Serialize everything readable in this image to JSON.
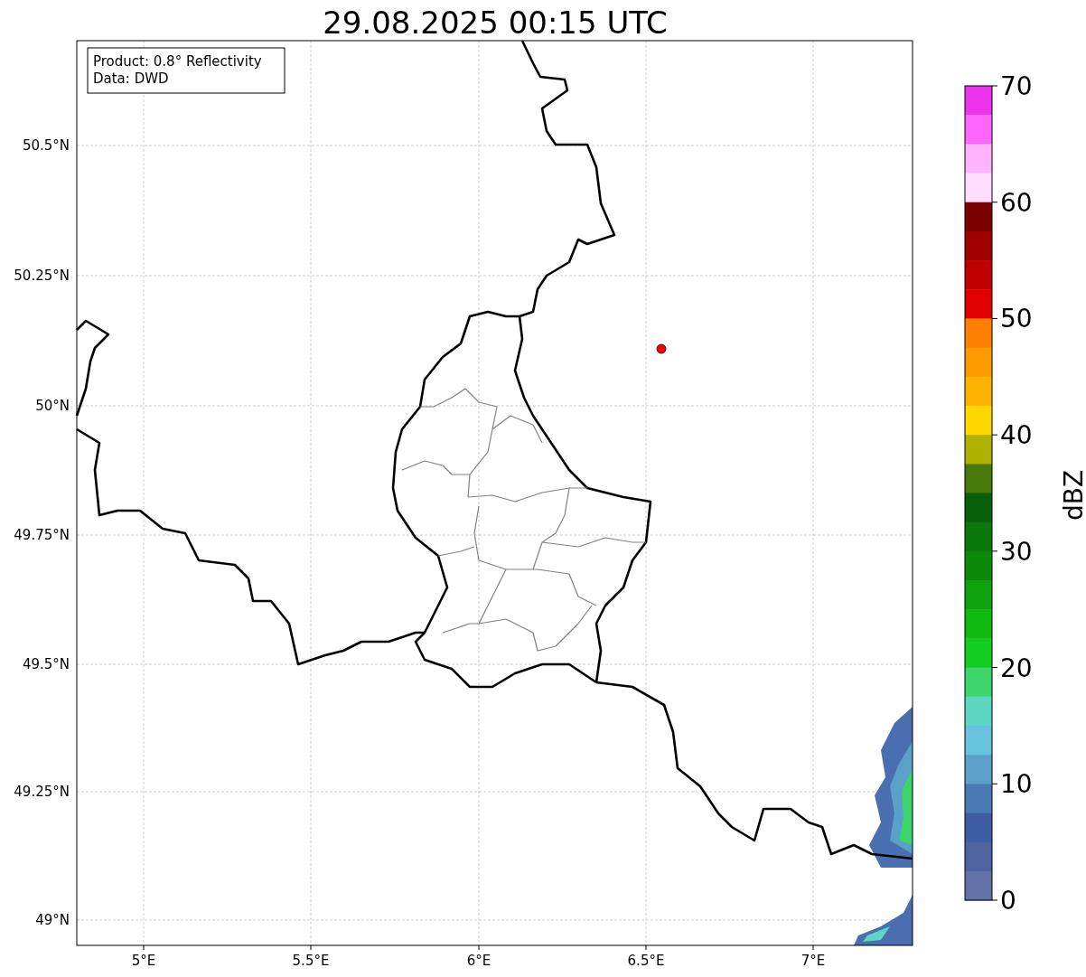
{
  "title": "29.08.2025 00:15 UTC",
  "info_box": [
    "Product: 0.8° Reflectivity",
    "Data: DWD"
  ],
  "x_tick_labels": [
    "5°E",
    "5.5°E",
    "6°E",
    "6.5°E",
    "7°E"
  ],
  "y_tick_labels": [
    "50.5°N",
    "50.25°N",
    "50°N",
    "49.75°N",
    "49.5°N",
    "49.25°N",
    "49°N"
  ],
  "colorbar": {
    "label": "dBZ",
    "tick_labels": [
      "70",
      "60",
      "50",
      "40",
      "30",
      "20",
      "10",
      "0"
    ],
    "bins": [
      {
        "color": "#ee33ee"
      },
      {
        "color": "#ff66ff"
      },
      {
        "color": "#ffb3ff"
      },
      {
        "color": "#ffddff"
      },
      {
        "color": "#7b0000"
      },
      {
        "color": "#a00000"
      },
      {
        "color": "#c00000"
      },
      {
        "color": "#e00000"
      },
      {
        "color": "#ff7f00"
      },
      {
        "color": "#ff9900"
      },
      {
        "color": "#ffb300"
      },
      {
        "color": "#ffd700"
      },
      {
        "color": "#b0b000"
      },
      {
        "color": "#477a0a"
      },
      {
        "color": "#075f07"
      },
      {
        "color": "#0a770a"
      },
      {
        "color": "#0b8a0b"
      },
      {
        "color": "#0ea30e"
      },
      {
        "color": "#10ba10"
      },
      {
        "color": "#12cc22"
      },
      {
        "color": "#3dd46a"
      },
      {
        "color": "#5ed6c4"
      },
      {
        "color": "#66c2dd"
      },
      {
        "color": "#5aa0c8"
      },
      {
        "color": "#4a7ab3"
      },
      {
        "color": "#3e5ea3"
      },
      {
        "color": "#4f63a0"
      },
      {
        "color": "#6272a8"
      }
    ]
  }
}
